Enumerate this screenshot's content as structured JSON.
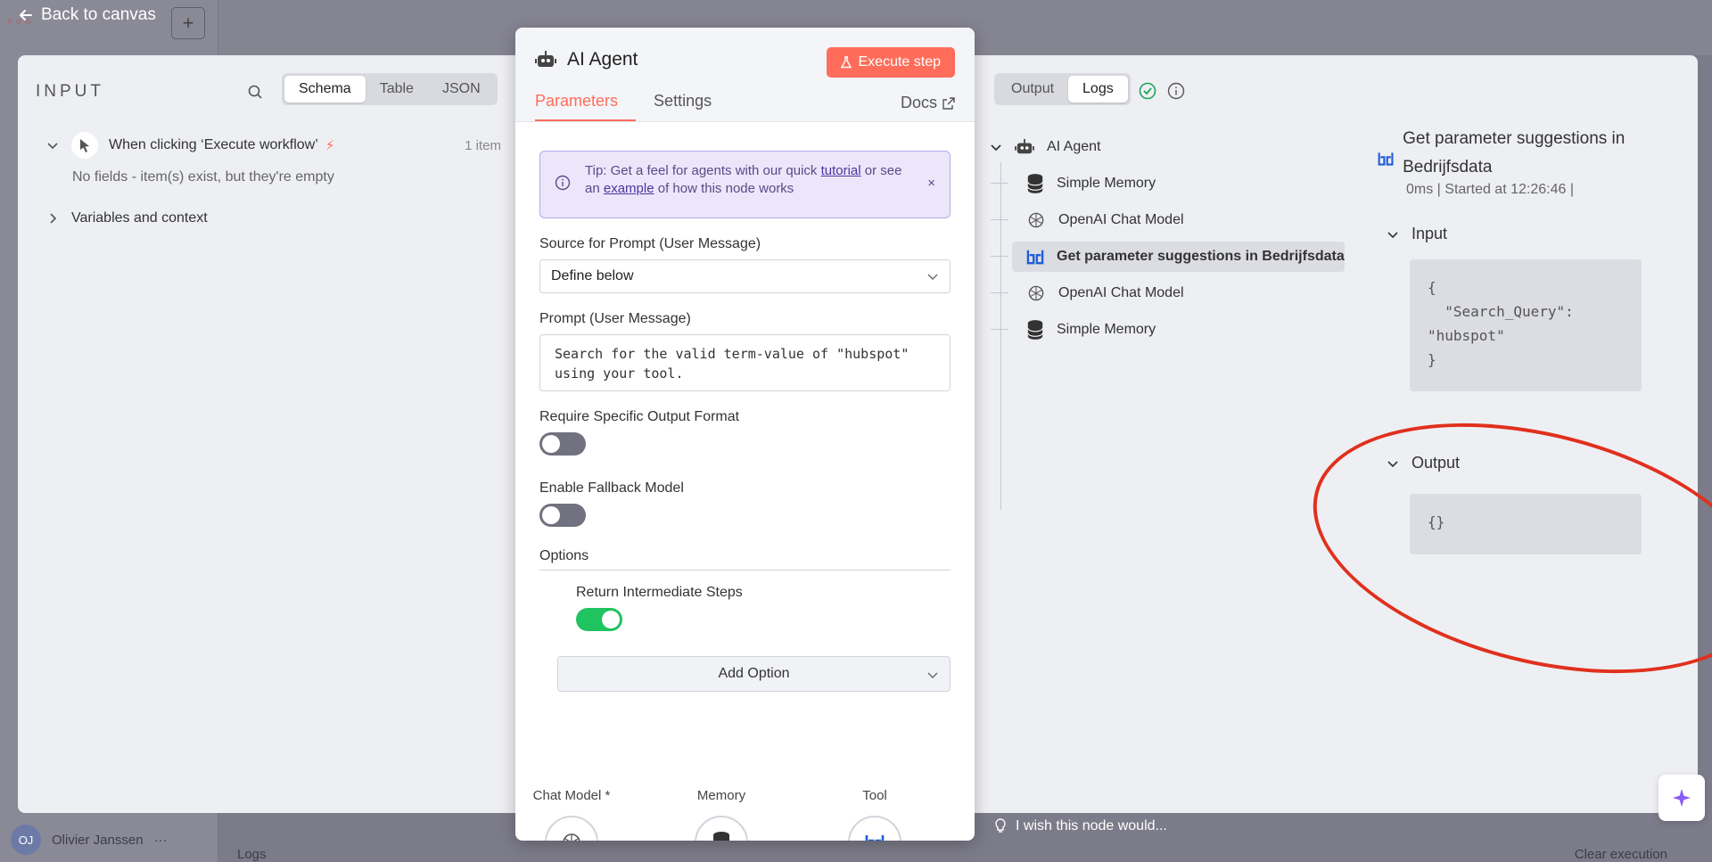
{
  "background": {
    "back_label": "Back to canvas",
    "user_initials": "OJ",
    "user_name": "Olivier Janssen",
    "logs_label": "Logs",
    "clear_label": "Clear execution",
    "wish_label": "I wish this node would..."
  },
  "input": {
    "title": "INPUT",
    "tabs": [
      "Schema",
      "Table",
      "JSON"
    ],
    "active_tab": "Schema",
    "trigger_label": "When clicking ‘Execute workflow’",
    "item_count": "1 item",
    "empty_note": "No fields - item(s) exist, but they're empty",
    "vars_label": "Variables and context"
  },
  "node": {
    "title": "AI Agent",
    "execute_label": "Execute step",
    "tabs": [
      "Parameters",
      "Settings"
    ],
    "docs_label": "Docs",
    "tip_prefix": "Tip: Get a feel for agents with our quick ",
    "tip_link1": "tutorial",
    "tip_mid": " or see an ",
    "tip_link2": "example",
    "tip_suffix": " of how this node works",
    "tip_close": "×",
    "source_label": "Source for Prompt (User Message)",
    "source_value": "Define below",
    "prompt_label": "Prompt (User Message)",
    "prompt_value": "Search for the valid term-value of \"hubspot\" using your tool.",
    "output_format_label": "Require Specific Output Format",
    "output_format_on": false,
    "fallback_label": "Enable Fallback Model",
    "fallback_on": false,
    "options_label": "Options",
    "intermediate_label": "Return Intermediate Steps",
    "intermediate_on": true,
    "add_option_label": "Add Option",
    "connectors": [
      "Chat Model *",
      "Memory",
      "Tool"
    ]
  },
  "output": {
    "tabs": [
      "Output",
      "Logs"
    ],
    "active_tab": "Logs",
    "tree_root": "AI Agent",
    "tree_items": [
      {
        "label": "Simple Memory",
        "icon": "database-icon"
      },
      {
        "label": "OpenAI Chat Model",
        "icon": "openai-icon"
      },
      {
        "label": "Get parameter suggestions in Bedrijfsdata",
        "icon": "bedrijfsdata-icon"
      },
      {
        "label": "OpenAI Chat Model",
        "icon": "openai-icon"
      },
      {
        "label": "Simple Memory",
        "icon": "database-icon"
      }
    ],
    "selected_index": 2,
    "detail_title": "Get parameter suggestions in Bedrijfsdata",
    "detail_meta": "0ms | Started at 12:26:46 |",
    "input_section": "Input",
    "input_json": "{\n  \"Search_Query\":\n\"hubspot\"\n}",
    "output_section": "Output",
    "output_json": "{}"
  },
  "colors": {
    "accent": "#ff6d5a",
    "toggle_on": "#1fc35f",
    "annotation": "#e0301e"
  }
}
